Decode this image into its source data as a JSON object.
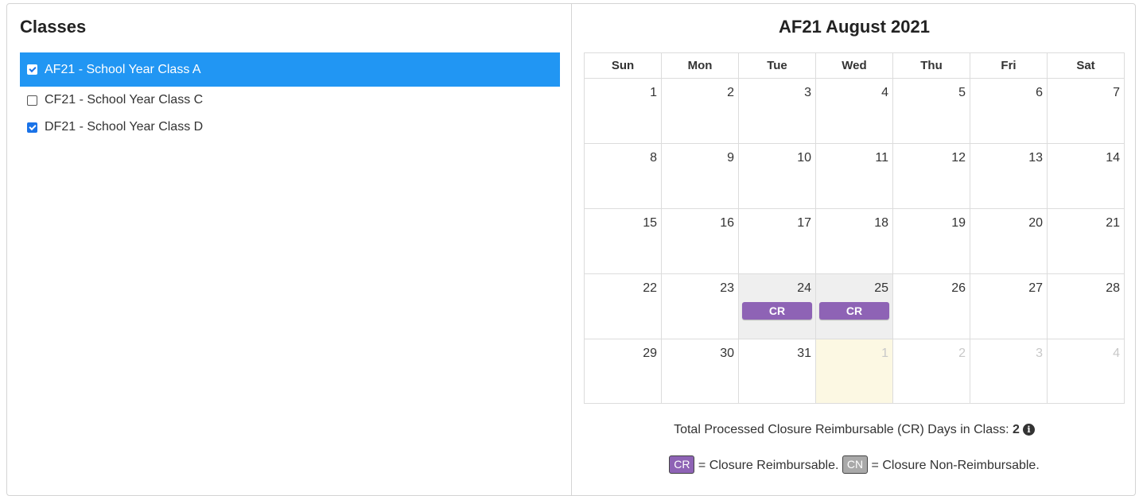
{
  "classes": {
    "title": "Classes",
    "items": [
      {
        "label": "AF21 - School Year Class A",
        "checked": true,
        "selected": true
      },
      {
        "label": "CF21 - School Year Class C",
        "checked": false,
        "selected": false
      },
      {
        "label": "DF21 - School Year Class D",
        "checked": true,
        "selected": false
      }
    ]
  },
  "calendar": {
    "title": "AF21 August 2021",
    "weekdays": [
      "Sun",
      "Mon",
      "Tue",
      "Wed",
      "Thu",
      "Fri",
      "Sat"
    ],
    "weeks": [
      [
        {
          "d": "1"
        },
        {
          "d": "2"
        },
        {
          "d": "3"
        },
        {
          "d": "4"
        },
        {
          "d": "5"
        },
        {
          "d": "6"
        },
        {
          "d": "7"
        }
      ],
      [
        {
          "d": "8"
        },
        {
          "d": "9"
        },
        {
          "d": "10"
        },
        {
          "d": "11"
        },
        {
          "d": "12"
        },
        {
          "d": "13"
        },
        {
          "d": "14"
        }
      ],
      [
        {
          "d": "15"
        },
        {
          "d": "16"
        },
        {
          "d": "17"
        },
        {
          "d": "18"
        },
        {
          "d": "19"
        },
        {
          "d": "20"
        },
        {
          "d": "21"
        }
      ],
      [
        {
          "d": "22"
        },
        {
          "d": "23"
        },
        {
          "d": "24",
          "badge": "CR"
        },
        {
          "d": "25",
          "badge": "CR"
        },
        {
          "d": "26"
        },
        {
          "d": "27"
        },
        {
          "d": "28"
        }
      ],
      [
        {
          "d": "29"
        },
        {
          "d": "30"
        },
        {
          "d": "31"
        },
        {
          "d": "1",
          "other": true,
          "today": true
        },
        {
          "d": "2",
          "other": true
        },
        {
          "d": "3",
          "other": true
        },
        {
          "d": "4",
          "other": true
        }
      ]
    ],
    "badge_color": "#8e63b5",
    "today_color": "#fcf8e3"
  },
  "summary": {
    "total_text": "Total Processed Closure Reimbursable (CR) Days in Class: ",
    "total_value": "2",
    "info_icon": "info-circle-icon"
  },
  "legend": {
    "cr_chip": "CR",
    "cr_text": " = Closure Reimbursable. ",
    "cn_chip": "CN",
    "cn_text": " = Closure Non-Reimbursable.",
    "cr_color": "#8e63b5",
    "cn_color": "#a9a9a9"
  }
}
